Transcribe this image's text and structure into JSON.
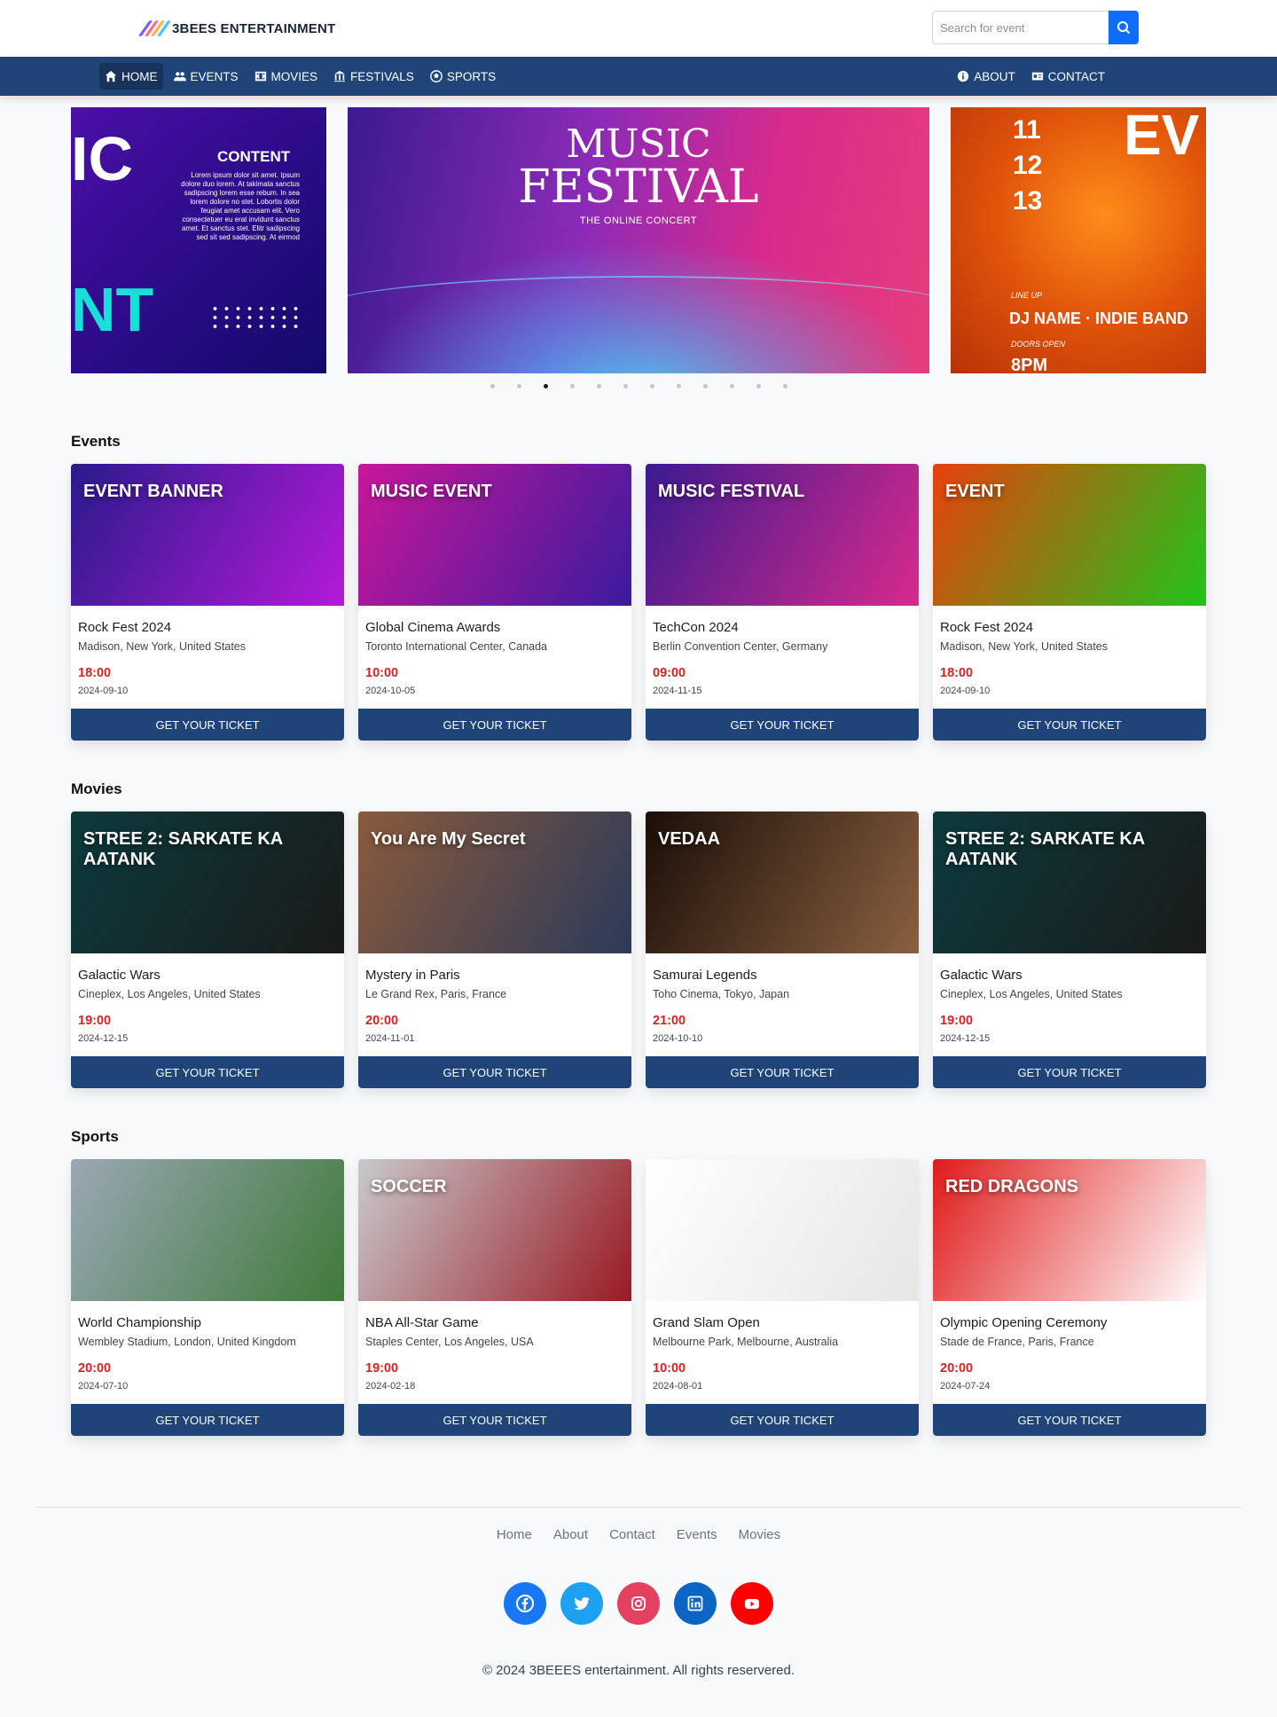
{
  "header": {
    "brand": "3BEES ENTERTAINMENT",
    "search_placeholder": "Search for event"
  },
  "nav": {
    "left": [
      {
        "label": "HOME",
        "icon": "home-icon",
        "active": true
      },
      {
        "label": "EVENTS",
        "icon": "users-icon"
      },
      {
        "label": "MOVIES",
        "icon": "film-icon"
      },
      {
        "label": "FESTIVALS",
        "icon": "landmark-icon"
      },
      {
        "label": "SPORTS",
        "icon": "ball-icon"
      }
    ],
    "right": [
      {
        "label": "ABOUT",
        "icon": "info-icon"
      },
      {
        "label": "CONTACT",
        "icon": "id-card-icon"
      }
    ]
  },
  "carousel": {
    "left_slide": {
      "heading": "CONTENT",
      "body": "Lorem ipsum dolor sit amet. Ipsum dolore duo lorem. At takimata sanctus sadipscing lorem esse rebum. In sea lorem dolore no stet. Lobortis dolor feugiat amet accusam elit. Vero consectetuer eu erat invidunt sanctus amet. Et sanctus stet. Elitr sadipscing sed sit sed sadipscing. At eirmod",
      "big_text_1": "IC",
      "big_text_2": "NT"
    },
    "main_slide": {
      "title_1": "MUSIC",
      "title_2": "FESTIVAL",
      "subtitle": "THE ONLINE CONCERT"
    },
    "right_slide": {
      "dates": [
        "11",
        "12",
        "13"
      ],
      "big_text": "EV",
      "lineup": "LINE UP",
      "headliners": "DJ NAME · INDIE BAND",
      "doors": "DOORS OPEN",
      "time": "8PM"
    },
    "dot_count": 12,
    "active_dot": 3
  },
  "sections": {
    "events": {
      "title": "Events",
      "cards": [
        {
          "title": "Rock Fest 2024",
          "location": "Madison, New York, United States",
          "time": "18:00",
          "date": "2024-09-10",
          "button": "GET YOUR TICKET",
          "image_text": "EVENT BANNER",
          "image_colors": [
            "#2a1a8c",
            "#b41ad8"
          ]
        },
        {
          "title": "Global Cinema Awards",
          "location": "Toronto International Center, Canada",
          "time": "10:00",
          "date": "2024-10-05",
          "button": "GET YOUR TICKET",
          "image_text": "MUSIC EVENT",
          "image_colors": [
            "#c8189a",
            "#3b1a9e"
          ]
        },
        {
          "title": "TechCon 2024",
          "location": "Berlin Convention Center, Germany",
          "time": "09:00",
          "date": "2024-11-15",
          "button": "GET YOUR TICKET",
          "image_text": "MUSIC FESTIVAL",
          "image_colors": [
            "#3b1a8f",
            "#d82a8c"
          ]
        },
        {
          "title": "Rock Fest 2024",
          "location": "Madison, New York, United States",
          "time": "18:00",
          "date": "2024-09-10",
          "button": "GET YOUR TICKET",
          "image_text": "EVENT",
          "image_colors": [
            "#e8400c",
            "#1fc41a"
          ]
        }
      ]
    },
    "movies": {
      "title": "Movies",
      "cards": [
        {
          "title": "Galactic Wars",
          "location": "Cineplex, Los Angeles, United States",
          "time": "19:00",
          "date": "2024-12-15",
          "button": "GET YOUR TICKET",
          "image_text": "STREE 2: SARKATE KA AATANK",
          "image_colors": [
            "#0d3a3c",
            "#1a1a1a"
          ]
        },
        {
          "title": "Mystery in Paris",
          "location": "Le Grand Rex, Paris, France",
          "time": "20:00",
          "date": "2024-11-01",
          "button": "GET YOUR TICKET",
          "image_text": "You Are My Secret",
          "image_colors": [
            "#8a5a3c",
            "#2b3a5a"
          ]
        },
        {
          "title": "Samurai Legends",
          "location": "Toho Cinema, Tokyo, Japan",
          "time": "21:00",
          "date": "2024-10-10",
          "button": "GET YOUR TICKET",
          "image_text": "VEDAA",
          "image_colors": [
            "#1a0e08",
            "#8a6040"
          ]
        },
        {
          "title": "Galactic Wars",
          "location": "Cineplex, Los Angeles, United States",
          "time": "19:00",
          "date": "2024-12-15",
          "button": "GET YOUR TICKET",
          "image_text": "STREE 2: SARKATE KA AATANK",
          "image_colors": [
            "#0d3a3c",
            "#1a1a1a"
          ]
        }
      ]
    },
    "sports": {
      "title": "Sports",
      "cards": [
        {
          "title": "World Championship",
          "location": "Wembley Stadium, London, United Kingdom",
          "time": "20:00",
          "date": "2024-07-10",
          "button": "GET YOUR TICKET",
          "image_text": "",
          "image_colors": [
            "#9aa7b4",
            "#3f7a3a"
          ]
        },
        {
          "title": "NBA All-Star Game",
          "location": "Staples Center, Los Angeles, USA",
          "time": "19:00",
          "date": "2024-02-18",
          "button": "GET YOUR TICKET",
          "image_text": "SOCCER",
          "image_colors": [
            "#c7c9cc",
            "#9a1a24"
          ]
        },
        {
          "title": "Grand Slam Open",
          "location": "Melbourne Park, Melbourne, Australia",
          "time": "10:00",
          "date": "2024-08-01",
          "button": "GET YOUR TICKET",
          "image_text": "",
          "image_colors": [
            "#ffffff",
            "#e6e6e6"
          ]
        },
        {
          "title": "Olympic Opening Ceremony",
          "location": "Stade de France, Paris, France",
          "time": "20:00",
          "date": "2024-07-24",
          "button": "GET YOUR TICKET",
          "image_text": "RED DRAGONS",
          "image_colors": [
            "#e01a1a",
            "#ffffff"
          ]
        }
      ]
    }
  },
  "footer": {
    "links": [
      "Home",
      "About",
      "Contact",
      "Events",
      "Movies"
    ],
    "socials": [
      {
        "name": "facebook-icon",
        "color": "#1877f2"
      },
      {
        "name": "twitter-icon",
        "color": "#1da1f2"
      },
      {
        "name": "instagram-icon",
        "color": "#e4405f"
      },
      {
        "name": "linkedin-icon",
        "color": "#0a66c2"
      },
      {
        "name": "youtube-icon",
        "color": "#ff0000"
      }
    ],
    "copyright": "© 2024 3BEEES entertainment. All rights reservered."
  }
}
